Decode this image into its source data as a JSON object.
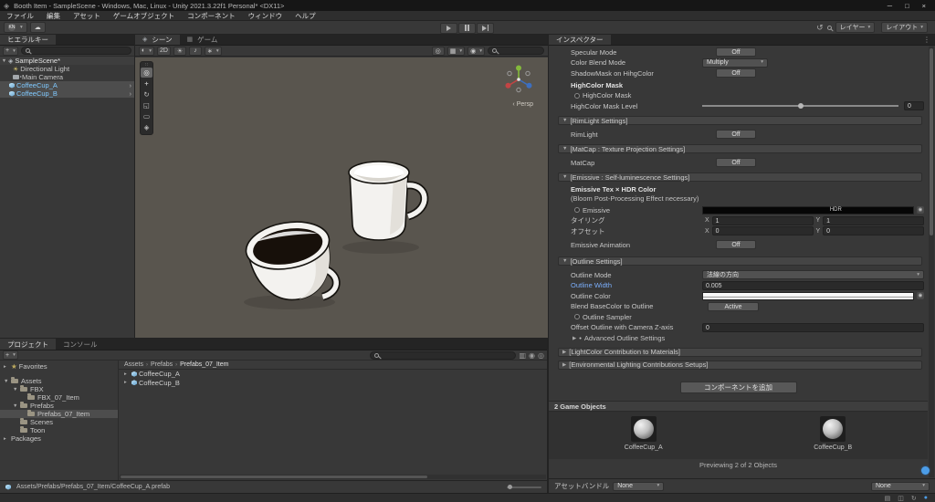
{
  "window": {
    "title": "Booth Item - SampleScene - Windows, Mac, Linux - Unity 2021.3.22f1 Personal* <DX11>"
  },
  "menu": {
    "items": [
      "ファイル",
      "編集",
      "アセット",
      "ゲームオブジェクト",
      "コンポーネント",
      "ウィンドウ",
      "ヘルプ"
    ]
  },
  "toolbar": {
    "account_initials": "KN",
    "layers_label": "レイヤー",
    "layout_label": "レイアウト"
  },
  "hierarchy": {
    "tab": "ヒエラルキー",
    "scene": "SampleScene*",
    "items": [
      {
        "label": "Directional Light"
      },
      {
        "label": "Main Camera"
      },
      {
        "label": "CoffeeCup_A"
      },
      {
        "label": "CoffeeCup_B"
      }
    ]
  },
  "scene_view": {
    "tab_scene": "シーン",
    "tab_game": "ゲーム",
    "label_2d": "2D",
    "projection": "Persp"
  },
  "project": {
    "tab_project": "プロジェクト",
    "tab_console": "コンソール",
    "favorites_label": "Favorites",
    "tree": [
      "Assets",
      "FBX",
      "FBX_07_Item",
      "Prefabs",
      "Prefabs_07_Item",
      "Scenes",
      "Toon",
      "Packages"
    ],
    "breadcrumb": [
      "Assets",
      "Prefabs",
      "Prefabs_07_Item"
    ],
    "files": [
      {
        "name": "CoffeeCup_A"
      },
      {
        "name": "CoffeeCup_B"
      }
    ],
    "status_path": "Assets/Prefabs/Prefabs_07_Item/CoffeeCup_A.prefab"
  },
  "inspector": {
    "tab": "インスペクター",
    "specular_mode": {
      "label": "Specular Mode",
      "value": "Off"
    },
    "color_blend_mode": {
      "label": "Color Blend Mode",
      "value": "Multiply"
    },
    "shadowmask_on_highcolor": {
      "label": "ShadowMask on HihgColor",
      "value": "Off"
    },
    "highcolor_mask_header": "HighColor Mask",
    "highcolor_mask_slot": "HighColor Mask",
    "highcolor_mask_level": {
      "label": "HighColor Mask Level",
      "value": "0"
    },
    "rimlight_section": "[RimLight Settings]",
    "rimlight": {
      "label": "RimLight",
      "value": "Off"
    },
    "matcap_section": "[MatCap : Texture Projection Settings]",
    "matcap": {
      "label": "MatCap",
      "value": "Off"
    },
    "emissive_section": "[Emissive : Self-luminescence Settings]",
    "emissive_header": "Emissive Tex × HDR Color",
    "emissive_note": "(Bloom Post-Processing Effect necessary)",
    "emissive_slot": "Emissive",
    "hdr_badge": "HDR",
    "tiling": {
      "label": "タイリング",
      "x_label": "X",
      "x": "1",
      "y_label": "Y",
      "y": "1"
    },
    "offset": {
      "label": "オフセット",
      "x_label": "X",
      "x": "0",
      "y_label": "Y",
      "y": "0"
    },
    "emissive_animation": {
      "label": "Emissive Animation",
      "value": "Off"
    },
    "outline_section": "[Outline Settings]",
    "outline_mode": {
      "label": "Outline Mode",
      "value": "法線の方向"
    },
    "outline_width": {
      "label": "Outline Width",
      "value": "0.005"
    },
    "outline_color_label": "Outline Color",
    "blend_basecolor": {
      "label": "Blend BaseColor to Outline",
      "value": "Active"
    },
    "outline_sampler_slot": "Outline Sampler",
    "offset_outline_z": {
      "label": "Offset Outline with Camera Z-axis",
      "value": "0"
    },
    "advanced_outline": "Advanced Outline Settings",
    "lightcolor_section": "[LightColor Contribution to Materials]",
    "env_section": "[Environmental Lighting Contributions Setups]",
    "add_component": "コンポーネントを追加",
    "selection_header": "2 Game Objects",
    "previews": [
      {
        "name": "CoffeeCup_A"
      },
      {
        "name": "CoffeeCup_B"
      }
    ],
    "preview_note": "Previewing 2 of 2 Objects",
    "assetbundle": {
      "label": "アセットバンドル",
      "bundle": "None",
      "variant": "None"
    }
  },
  "colors": {
    "prefab_link": "#7FC9FF",
    "modified_property": "#7BAEFB",
    "selection": "#4D4D4D",
    "scene_background": "#59554E",
    "badge_blue": "#4C9DE8"
  }
}
